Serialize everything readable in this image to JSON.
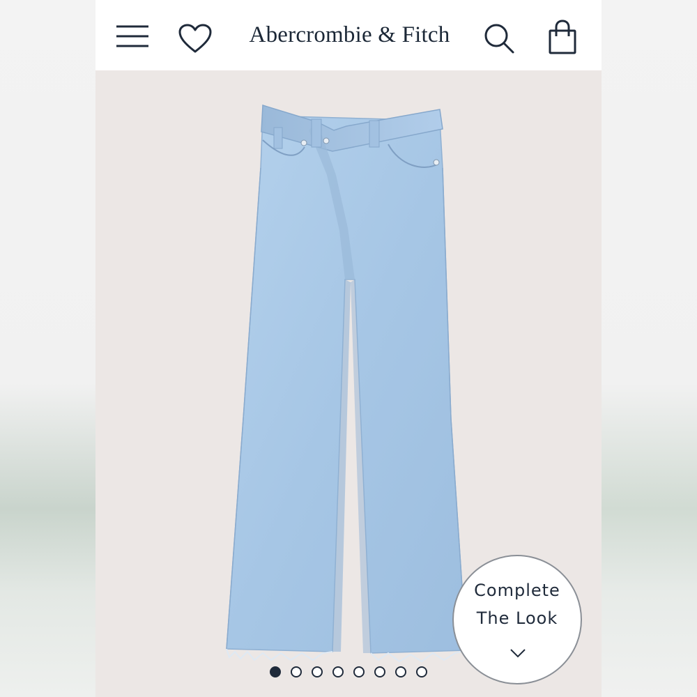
{
  "header": {
    "brand": "Abercrombie & Fitch",
    "icons": {
      "menu": "hamburger-menu-icon",
      "wishlist": "heart-icon",
      "search": "search-icon",
      "bag": "shopping-bag-icon"
    }
  },
  "gallery": {
    "total_images": 8,
    "active_index": 0
  },
  "complete_look": {
    "line1": "Complete",
    "line2": "The Look",
    "icon": "chevron-down-icon"
  },
  "colors": {
    "brand_navy": "#1b2736",
    "denim": "#a9c8e6",
    "background": "#ece7e5"
  }
}
